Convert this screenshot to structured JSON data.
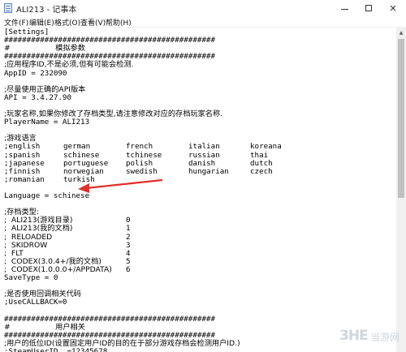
{
  "window": {
    "title": "ALI213 - 记事本",
    "minimize_label": "",
    "maximize_label": "",
    "close_label": "✕"
  },
  "menu": [
    "文件(F)",
    "编辑(E)",
    "格式(O)",
    "查看(V)",
    "帮助(H)"
  ],
  "editor": {
    "lines": [
      "[Settings]",
      "###############################################",
      "#                   模拟参数",
      "###############################################",
      ";应用程序ID,不是必须,但有可能会检测.",
      "AppID = 232090",
      "",
      ";尽量使用正确的API版本",
      "API = 3.4.27.90",
      "",
      ";玩家名称,如果你修改了存档类型,请注意修改对应的存档玩家名称.",
      "PlayerName = ALI213",
      "",
      ";游戏语言",
      "",
      "",
      "",
      "",
      "",
      "",
      "Language = schinese",
      "",
      ";存档类型:",
      "",
      "",
      "",
      "",
      "",
      "",
      "",
      "SaveType = 0",
      "",
      ";是否使用回调相关代码",
      ";UseCALLBACK=0",
      "",
      "###############################################",
      "#                   用户相关",
      "###############################################",
      ";用户的低位ID(设置固定用户ID的目的在于部分游戏存档会检测用户ID.)",
      ";SteamUserID  =12345678"
    ],
    "languages": [
      [
        ";english",
        "german",
        "french",
        "italian",
        "koreana"
      ],
      [
        ";spanish",
        "schinese",
        "tchinese",
        "russian",
        "thai"
      ],
      [
        ";japanese",
        "portuguese",
        "polish",
        "danish",
        "dutch"
      ],
      [
        ";finnish",
        "norwegian",
        "swedish",
        "hungarian",
        "czech"
      ],
      [
        ";romanian",
        "turkish",
        "",
        "",
        ""
      ]
    ],
    "save_types": [
      [
        ";  ALI213(游戏目录)",
        "0"
      ],
      [
        ";  ALI213(我的文档)",
        "1"
      ],
      [
        ";  RELOADED",
        "2"
      ],
      [
        ";  SKIDROW",
        "3"
      ],
      [
        ";  FLT",
        "4"
      ],
      [
        ";  CODEX(3.0.4+/我的文档)",
        "5"
      ],
      [
        ";  CODEX(1.0.0.0+/APPDATA)",
        "6"
      ]
    ]
  },
  "annotation": {
    "arrow_color": "#e0302b"
  },
  "watermark": {
    "logo": "3HE",
    "text": "当游网"
  }
}
